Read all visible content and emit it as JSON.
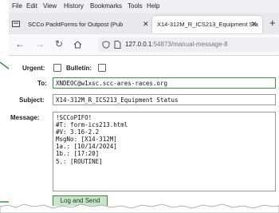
{
  "menu": [
    "File",
    "Edit",
    "View",
    "History",
    "Bookmarks",
    "Tools",
    "Help"
  ],
  "tabs": [
    {
      "label": "SCCo PacktForms for Outpost (Pub",
      "close": "✕",
      "active": false
    },
    {
      "label": "X14-312M_R_ICS213_Equipment Sta",
      "close": "✕",
      "active": true
    }
  ],
  "new_tab": "+",
  "url": {
    "host": "127.0.0.1",
    "path": ":54873/manual-message-8"
  },
  "form": {
    "urgent_label": "Urgent:",
    "bulletin_label": "Bulletin:",
    "to_label": "To:",
    "to_value": "XNDEOC@w1xsc.scc-ares-races.org",
    "subject_label": "Subject:",
    "subject_value": "X14-312M_R_ICS213_Equipment Status",
    "message_label": "Message:",
    "message_lines": [
      "!SCCoPIFO!",
      "#T: form-ics213.html",
      "#V: 3.16-2.2",
      "MsgNo: [X14-312M]",
      "1a.: [10/14/2024]",
      "1b.: [17:20]",
      "5.: [ROUTINE]"
    ],
    "send_button": "Log and Send"
  },
  "colors": {
    "highlight": "#2e9e3e",
    "send_button_bg": "#c8e6c9"
  },
  "icons": [
    "tab-list-icon",
    "back-icon",
    "forward-icon",
    "reload-icon",
    "home-icon",
    "shield-icon",
    "page-icon",
    "close-icon",
    "new-tab-icon"
  ]
}
